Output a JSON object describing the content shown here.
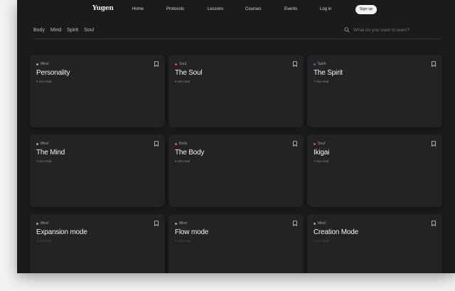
{
  "brand": "Yugen",
  "nav": {
    "links": [
      "Home",
      "Protocols",
      "Lessons",
      "Courses",
      "Events",
      "Log in"
    ],
    "signup": "Sign up"
  },
  "filters": [
    "Body",
    "Mind",
    "Spirit",
    "Soul"
  ],
  "search": {
    "placeholder": "What do you want to learn?"
  },
  "colors": {
    "Mind": "#8fbf3a",
    "Soul": "#e0466a",
    "Spirit": "#5b4fe0",
    "Body": "#e8642a"
  },
  "cards": [
    {
      "category": "Mind",
      "title": "Personality",
      "meta": "5 min read"
    },
    {
      "category": "Soul",
      "title": "The Soul",
      "meta": "8 min read"
    },
    {
      "category": "Spirit",
      "title": "The Spirit",
      "meta": "7 min read"
    },
    {
      "category": "Mind",
      "title": "The Mind",
      "meta": "7 min read"
    },
    {
      "category": "Body",
      "title": "The Body",
      "meta": "9 min read"
    },
    {
      "category": "Soul",
      "title": "Ikigai",
      "meta": "7 min read"
    },
    {
      "category": "Mind",
      "title": "Expansion mode",
      "meta": "3 min read"
    },
    {
      "category": "Mind",
      "title": "Flow mode",
      "meta": "3 min read"
    },
    {
      "category": "Mind",
      "title": "Creation Mode",
      "meta": "3 min read"
    }
  ]
}
